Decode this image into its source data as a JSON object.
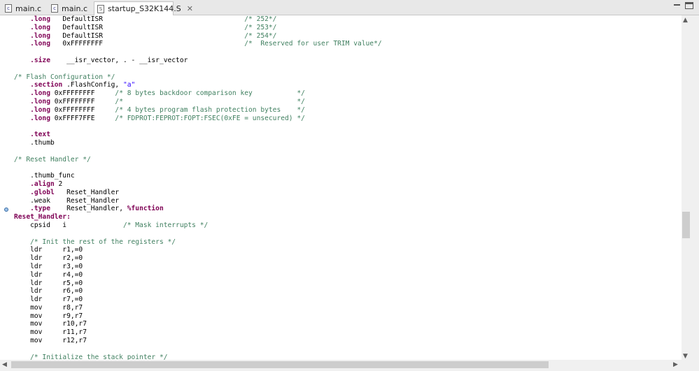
{
  "tabs": [
    {
      "label": "main.c",
      "icon": "c-file-icon",
      "active": false
    },
    {
      "label": "main.c",
      "icon": "c-file-icon",
      "active": false
    },
    {
      "label": "startup_S32K144.S",
      "icon": "asm-file-icon",
      "active": true,
      "close": "✕"
    }
  ],
  "colors": {
    "directive": "#7f0055",
    "comment": "#3f7f5f",
    "string": "#2a00ff",
    "marker": "#9cc0e8"
  },
  "code": {
    "lines": [
      [
        [
          "    ",
          ""
        ],
        [
          ".long",
          "dir"
        ],
        [
          "   DefaultISR                                   ",
          ""
        ],
        [
          "/* 252*/",
          "cm"
        ]
      ],
      [
        [
          "    ",
          ""
        ],
        [
          ".long",
          "dir"
        ],
        [
          "   DefaultISR                                   ",
          ""
        ],
        [
          "/* 253*/",
          "cm"
        ]
      ],
      [
        [
          "    ",
          ""
        ],
        [
          ".long",
          "dir"
        ],
        [
          "   DefaultISR                                   ",
          ""
        ],
        [
          "/* 254*/",
          "cm"
        ]
      ],
      [
        [
          "    ",
          ""
        ],
        [
          ".long",
          "dir"
        ],
        [
          "   0xFFFFFFFF                                   ",
          ""
        ],
        [
          "/*  Reserved for user TRIM value*/",
          "cm"
        ]
      ],
      [
        [
          "",
          ""
        ]
      ],
      [
        [
          "    ",
          ""
        ],
        [
          ".size",
          "dir"
        ],
        [
          "    __isr_vector, . - __isr_vector",
          ""
        ]
      ],
      [
        [
          "",
          ""
        ]
      ],
      [
        [
          "/* Flash Configuration */",
          "cm"
        ]
      ],
      [
        [
          "    ",
          ""
        ],
        [
          ".section",
          "dir"
        ],
        [
          " .FlashConfig, ",
          ""
        ],
        [
          "\"a\"",
          "str"
        ]
      ],
      [
        [
          "    ",
          ""
        ],
        [
          ".long",
          "dir"
        ],
        [
          " 0xFFFFFFFF     ",
          ""
        ],
        [
          "/* 8 bytes backdoor comparison key           */",
          "cm"
        ]
      ],
      [
        [
          "    ",
          ""
        ],
        [
          ".long",
          "dir"
        ],
        [
          " 0xFFFFFFFF     ",
          ""
        ],
        [
          "/*                                           */",
          "cm"
        ]
      ],
      [
        [
          "    ",
          ""
        ],
        [
          ".long",
          "dir"
        ],
        [
          " 0xFFFFFFFF     ",
          ""
        ],
        [
          "/* 4 bytes program flash protection bytes    */",
          "cm"
        ]
      ],
      [
        [
          "    ",
          ""
        ],
        [
          ".long",
          "dir"
        ],
        [
          " 0xFFFF7FFE     ",
          ""
        ],
        [
          "/* FDPROT:FEPROT:FOPT:FSEC(0xFE = unsecured) */",
          "cm"
        ]
      ],
      [
        [
          "",
          ""
        ]
      ],
      [
        [
          "    ",
          ""
        ],
        [
          ".text",
          "dir"
        ]
      ],
      [
        [
          "    .thumb",
          ""
        ]
      ],
      [
        [
          "",
          ""
        ]
      ],
      [
        [
          "/* Reset Handler */",
          "cm"
        ]
      ],
      [
        [
          "",
          ""
        ]
      ],
      [
        [
          "    .thumb_func",
          ""
        ]
      ],
      [
        [
          "    ",
          ""
        ],
        [
          ".align",
          "dir"
        ],
        [
          " 2",
          ""
        ]
      ],
      [
        [
          "    ",
          ""
        ],
        [
          ".globl",
          "dir"
        ],
        [
          "   Reset_Handler",
          ""
        ]
      ],
      [
        [
          "    .weak    Reset_Handler",
          ""
        ]
      ],
      [
        [
          "    ",
          ""
        ],
        [
          ".type",
          "dir"
        ],
        [
          "    Reset_Handler, ",
          ""
        ],
        [
          "%function",
          "pct"
        ]
      ],
      [
        [
          "Reset_Handler:",
          "lbl"
        ]
      ],
      [
        [
          "    cpsid   i              ",
          ""
        ],
        [
          "/* Mask interrupts */",
          "cm"
        ]
      ],
      [
        [
          "",
          ""
        ]
      ],
      [
        [
          "    ",
          ""
        ],
        [
          "/* Init the rest of the registers */",
          "cm"
        ]
      ],
      [
        [
          "    ldr     r1,=0",
          ""
        ]
      ],
      [
        [
          "    ldr     r2,=0",
          ""
        ]
      ],
      [
        [
          "    ldr     r3,=0",
          ""
        ]
      ],
      [
        [
          "    ldr     r4,=0",
          ""
        ]
      ],
      [
        [
          "    ldr     r5,=0",
          ""
        ]
      ],
      [
        [
          "    ldr     r6,=0",
          ""
        ]
      ],
      [
        [
          "    ldr     r7,=0",
          ""
        ]
      ],
      [
        [
          "    mov     r8,r7",
          ""
        ]
      ],
      [
        [
          "    mov     r9,r7",
          ""
        ]
      ],
      [
        [
          "    mov     r10,r7",
          ""
        ]
      ],
      [
        [
          "    mov     r11,r7",
          ""
        ]
      ],
      [
        [
          "    mov     r12,r7",
          ""
        ]
      ],
      [
        [
          "",
          ""
        ]
      ],
      [
        [
          "    ",
          ""
        ],
        [
          "/* Initialize the stack pointer */",
          "cm"
        ]
      ]
    ]
  }
}
